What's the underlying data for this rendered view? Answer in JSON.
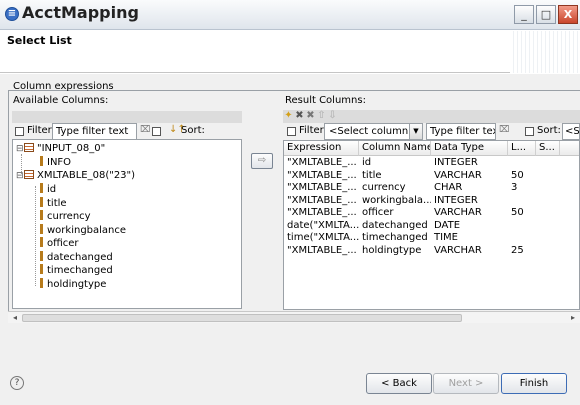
{
  "window": {
    "title": "AcctMapping",
    "controls": {
      "minimize": "_",
      "maximize": "□",
      "close": "X"
    }
  },
  "header": {
    "title": "Select List"
  },
  "group": {
    "label": "Column expressions"
  },
  "available": {
    "label": "Available Columns:",
    "filter_label": "Filter:",
    "filter_placeholder": "Type filter text",
    "sort_label": "Sort:",
    "tree": {
      "node1": {
        "label": "\"INPUT_08_0\"",
        "children": [
          "INFO"
        ]
      },
      "node2": {
        "label": "XMLTABLE_08(\"23\")",
        "children": [
          "id",
          "title",
          "currency",
          "workingbalance",
          "officer",
          "datechanged",
          "timechanged",
          "holdingtype"
        ]
      }
    }
  },
  "add_arrow": "⇨",
  "result": {
    "label": "Result Columns:",
    "filter_label": "Filter:",
    "select_column": "<Select column>",
    "filter_placeholder": "Type filter text",
    "sort_label": "Sort:",
    "sort_value": "<S",
    "headers": [
      "Expression",
      "Column Name",
      "Data Type",
      "L...",
      "S..."
    ],
    "rows": [
      [
        "\"XMLTABLE_...",
        "id",
        "INTEGER",
        "",
        ""
      ],
      [
        "\"XMLTABLE_...",
        "title",
        "VARCHAR",
        "50",
        ""
      ],
      [
        "\"XMLTABLE_...",
        "currency",
        "CHAR",
        "3",
        ""
      ],
      [
        "\"XMLTABLE_...",
        "workingbala...",
        "INTEGER",
        "",
        ""
      ],
      [
        "\"XMLTABLE_...",
        "officer",
        "VARCHAR",
        "50",
        ""
      ],
      [
        "date(\"XMLTA...",
        "datechanged",
        "DATE",
        "",
        ""
      ],
      [
        "time(\"XMLTA...",
        "timechanged",
        "TIME",
        "",
        ""
      ],
      [
        "\"XMLTABLE_...",
        "holdingtype",
        "VARCHAR",
        "25",
        ""
      ]
    ]
  },
  "buttons": {
    "help": "?",
    "back": "< Back",
    "next": "Next >",
    "finish": "Finish"
  }
}
